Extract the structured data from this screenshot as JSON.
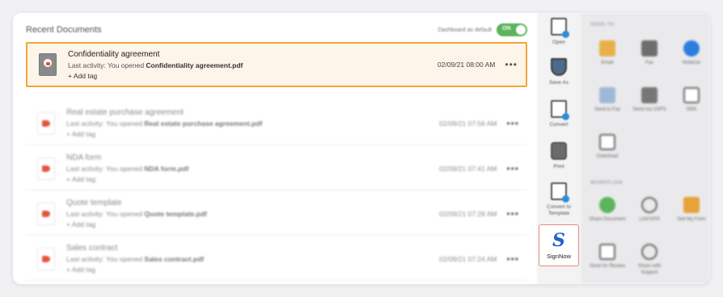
{
  "documents": {
    "title": "Recent Documents",
    "dashboard_default_label": "Dashboard as default",
    "toggle_label": "ON",
    "rows": [
      {
        "name": "Confidentiality agreement",
        "activity_prefix": "Last activity: You opened ",
        "file": "Confidentiality agreement.pdf",
        "tag": "+ Add tag",
        "date": "02/09/21 08:00 AM",
        "more": "•••"
      },
      {
        "name": "Real estate purchase agreement",
        "activity_prefix": "Last activity: You opened ",
        "file": "Real estate purchase agreement.pdf",
        "tag": "+ Add tag",
        "date": "02/09/21 07:56 AM",
        "more": "•••"
      },
      {
        "name": "NDA form",
        "activity_prefix": "Last activity: You opened ",
        "file": "NDA form.pdf",
        "tag": "+ Add tag",
        "date": "02/09/21 07:41 AM",
        "more": "•••"
      },
      {
        "name": "Quote template",
        "activity_prefix": "Last activity: You opened ",
        "file": "Quote template.pdf",
        "tag": "+ Add tag",
        "date": "02/09/21 07:28 AM",
        "more": "•••"
      },
      {
        "name": "Sales contract",
        "activity_prefix": "Last activity: You opened ",
        "file": "Sales contract.pdf",
        "tag": "+ Add tag",
        "date": "02/09/21 07:24 AM",
        "more": "•••"
      }
    ]
  },
  "toolbar": {
    "open": "Open",
    "save_as": "Save As",
    "convert": "Convert",
    "print": "Print",
    "convert_template": "Convert to Template",
    "signnow_icon": "S",
    "signnow": "SignNow"
  },
  "panel": {
    "send_to_title": "SEND TO",
    "workflow_title": "WORKFLOW",
    "email": "Email",
    "fax": "Fax",
    "notarize": "Notarize",
    "send_to_fax": "Send to Fax",
    "send_usps": "Send via USPS",
    "sms": "SMS",
    "download": "Download",
    "share_document": "Share Document",
    "link_to_fill": "LinkToFill",
    "sell_my_form": "Sell My Form",
    "send_for_review": "Send for Review",
    "share_with_support": "Share with Support"
  },
  "colors": {
    "highlight_border": "#f5a433",
    "toggle_on": "#5ab45a",
    "signnow_blue": "#1f5fd0"
  }
}
